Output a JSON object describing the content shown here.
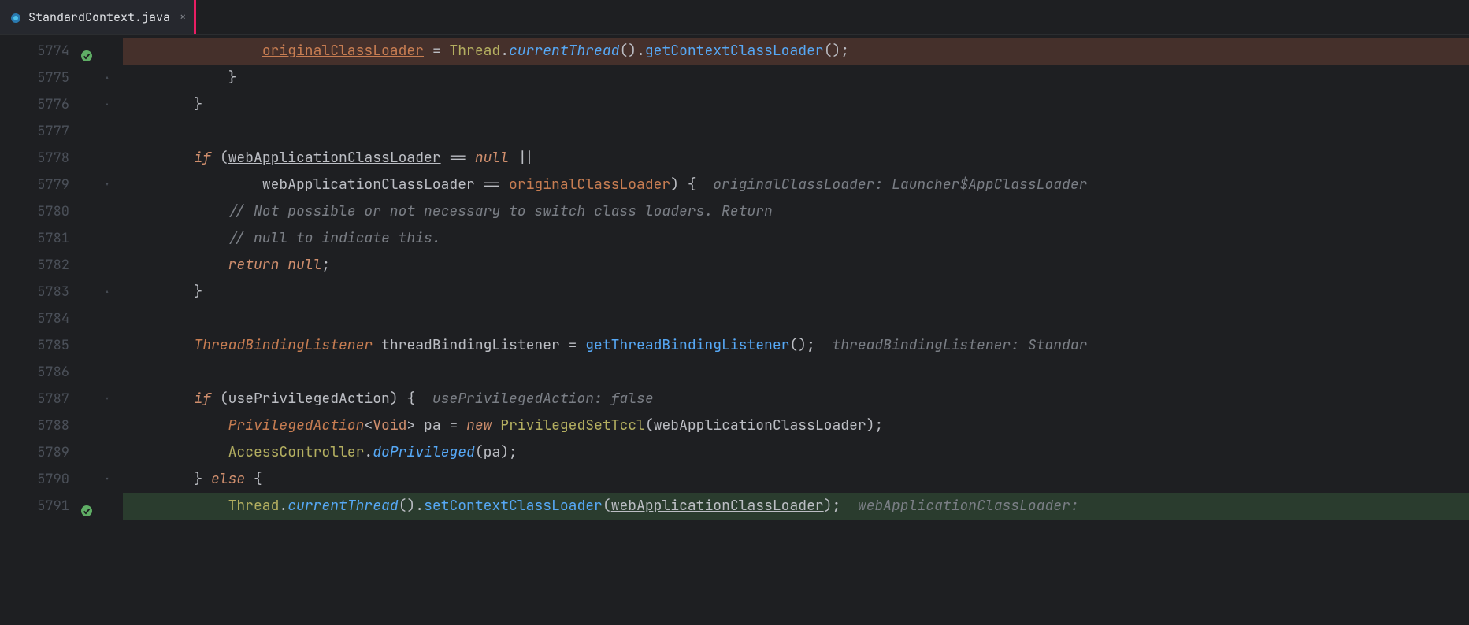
{
  "tab": {
    "filename": "StandardContext.java",
    "close_glyph": "×"
  },
  "lines": [
    {
      "num": "5774",
      "bp": true,
      "hl": "red",
      "indent": "                ",
      "tokens": [
        {
          "t": "originalClassLoader",
          "c": "var-u-orange"
        },
        {
          "t": " = ",
          "c": "op"
        },
        {
          "t": "Thread",
          "c": "type2"
        },
        {
          "t": ".",
          "c": "punct"
        },
        {
          "t": "currentThread",
          "c": "method-i"
        },
        {
          "t": "()",
          "c": "paren"
        },
        {
          "t": ".",
          "c": "punct"
        },
        {
          "t": "getContextClassLoader",
          "c": "method"
        },
        {
          "t": "();",
          "c": "paren"
        }
      ]
    },
    {
      "num": "5775",
      "fold": "end",
      "indent": "            ",
      "tokens": [
        {
          "t": "}",
          "c": "brace"
        }
      ]
    },
    {
      "num": "5776",
      "fold": "end",
      "indent": "        ",
      "tokens": [
        {
          "t": "}",
          "c": "brace"
        }
      ]
    },
    {
      "num": "5777",
      "indent": "",
      "tokens": []
    },
    {
      "num": "5778",
      "indent": "        ",
      "tokens": [
        {
          "t": "if",
          "c": "kw"
        },
        {
          "t": " (",
          "c": "paren"
        },
        {
          "t": "webApplicationClassLoader",
          "c": "var-u"
        },
        {
          "t": " == ",
          "c": "op"
        },
        {
          "t": "null",
          "c": "str-null"
        },
        {
          "t": " ||",
          "c": "op"
        }
      ]
    },
    {
      "num": "5779",
      "fold": "start",
      "indent": "                ",
      "tokens": [
        {
          "t": "webApplicationClassLoader",
          "c": "var-u"
        },
        {
          "t": " == ",
          "c": "op"
        },
        {
          "t": "originalClassLoader",
          "c": "var-u-orange"
        },
        {
          "t": ") {",
          "c": "paren"
        },
        {
          "t": "  originalClassLoader: Launcher$AppClassLoader",
          "c": "inlay"
        }
      ]
    },
    {
      "num": "5780",
      "indent": "            ",
      "tokens": [
        {
          "t": "// Not possible or not necessary to switch class loaders. Return",
          "c": "comment"
        }
      ]
    },
    {
      "num": "5781",
      "indent": "            ",
      "tokens": [
        {
          "t": "// null to indicate this.",
          "c": "comment"
        }
      ]
    },
    {
      "num": "5782",
      "indent": "            ",
      "tokens": [
        {
          "t": "return ",
          "c": "kw"
        },
        {
          "t": "null",
          "c": "str-null"
        },
        {
          "t": ";",
          "c": "punct"
        }
      ]
    },
    {
      "num": "5783",
      "fold": "end",
      "indent": "        ",
      "tokens": [
        {
          "t": "}",
          "c": "brace"
        }
      ]
    },
    {
      "num": "5784",
      "indent": "",
      "tokens": []
    },
    {
      "num": "5785",
      "indent": "        ",
      "tokens": [
        {
          "t": "ThreadBindingListener",
          "c": "type"
        },
        {
          "t": " threadBindingListener = ",
          "c": "local"
        },
        {
          "t": "getThreadBindingListener",
          "c": "method"
        },
        {
          "t": "();",
          "c": "paren"
        },
        {
          "t": "  threadBindingListener: Standar",
          "c": "inlay"
        }
      ]
    },
    {
      "num": "5786",
      "indent": "",
      "tokens": []
    },
    {
      "num": "5787",
      "fold": "start",
      "indent": "        ",
      "tokens": [
        {
          "t": "if",
          "c": "kw"
        },
        {
          "t": " (",
          "c": "paren"
        },
        {
          "t": "usePrivilegedAction",
          "c": "local"
        },
        {
          "t": ") {",
          "c": "paren"
        },
        {
          "t": "  usePrivilegedAction: false",
          "c": "inlay"
        }
      ]
    },
    {
      "num": "5788",
      "indent": "            ",
      "tokens": [
        {
          "t": "PrivilegedAction",
          "c": "type"
        },
        {
          "t": "<",
          "c": "op"
        },
        {
          "t": "Void",
          "c": "generic"
        },
        {
          "t": ">",
          "c": "op"
        },
        {
          "t": " pa = ",
          "c": "local"
        },
        {
          "t": "new ",
          "c": "kw"
        },
        {
          "t": "PrivilegedSetTccl",
          "c": "type2"
        },
        {
          "t": "(",
          "c": "paren"
        },
        {
          "t": "webApplicationClassLoader",
          "c": "var-u"
        },
        {
          "t": ");",
          "c": "paren"
        }
      ]
    },
    {
      "num": "5789",
      "indent": "            ",
      "tokens": [
        {
          "t": "AccessController",
          "c": "type2"
        },
        {
          "t": ".",
          "c": "punct"
        },
        {
          "t": "doPrivileged",
          "c": "method-i"
        },
        {
          "t": "(pa);",
          "c": "paren"
        }
      ]
    },
    {
      "num": "5790",
      "fold": "start",
      "indent": "        ",
      "tokens": [
        {
          "t": "} ",
          "c": "brace"
        },
        {
          "t": "else",
          "c": "kw"
        },
        {
          "t": " {",
          "c": "brace"
        }
      ]
    },
    {
      "num": "5791",
      "bp": true,
      "hl": "green",
      "indent": "            ",
      "tokens": [
        {
          "t": "Thread",
          "c": "type2"
        },
        {
          "t": ".",
          "c": "punct"
        },
        {
          "t": "currentThread",
          "c": "method-i"
        },
        {
          "t": "()",
          "c": "paren"
        },
        {
          "t": ".",
          "c": "punct"
        },
        {
          "t": "setContextClassLoader",
          "c": "method"
        },
        {
          "t": "(",
          "c": "paren"
        },
        {
          "t": "webApplicationClassLoader",
          "c": "var-u"
        },
        {
          "t": ");",
          "c": "paren"
        },
        {
          "t": "  webApplicationClassLoader:",
          "c": "inlay"
        }
      ]
    }
  ]
}
